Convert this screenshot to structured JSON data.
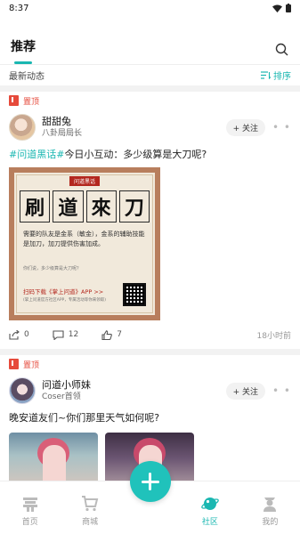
{
  "status_bar": {
    "time": "8:37"
  },
  "header": {
    "tab_label": "推荐",
    "search_icon": "search-icon"
  },
  "feed": {
    "title": "最新动态",
    "sort_label": "排序"
  },
  "posts": [
    {
      "pin_label": "置顶",
      "author_name": "甜甜兔",
      "author_title": "八卦局局长",
      "follow_label": "+ 关注",
      "hashtag": "#问道黑话#",
      "text": "今日小互动：多少级算是大刀呢?",
      "poster": {
        "tag": "问道黑话",
        "chars": [
          "刷",
          "道",
          "來",
          "刀"
        ],
        "body": "需要的队友是金系（敏金），金系的辅助技能是加刀，加刀提供伤害加成。",
        "small": "你们说，多少级算是大刀呢？",
        "cta": "扫码下载《掌上问道》APP >>",
        "note": "(掌上问道官方社区APP，专属活动等你来领取)"
      },
      "shares": "0",
      "comments": "12",
      "likes": "7",
      "time": "18小时前"
    },
    {
      "pin_label": "置顶",
      "author_name": "问道小师妹",
      "author_title": "Coser首领",
      "follow_label": "+ 关注",
      "text": "晚安道友们~你们那里天气如何呢?"
    }
  ],
  "nav": {
    "items": [
      {
        "label": "首页",
        "icon": "home-icon"
      },
      {
        "label": "商城",
        "icon": "cart-icon"
      },
      {
        "label": "社区",
        "icon": "planet-icon"
      },
      {
        "label": "我的",
        "icon": "profile-icon"
      }
    ],
    "fab_icon": "plus-icon",
    "accent": "#1ab7b1"
  }
}
